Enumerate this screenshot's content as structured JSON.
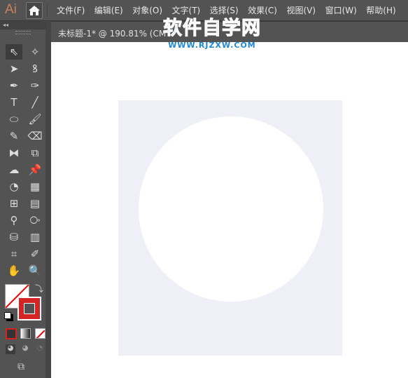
{
  "app": {
    "logo": "Ai",
    "home_icon": "home-icon"
  },
  "menu": [
    "文件(F)",
    "编辑(E)",
    "对象(O)",
    "文字(T)",
    "选择(S)",
    "效果(C)",
    "视图(V)",
    "窗口(W)",
    "帮助(H)"
  ],
  "document_tab": {
    "title": "未标题-1* @ 190.81% (CM"
  },
  "watermark": {
    "title": "软件自学网",
    "url": "WWW.RJZXW.COM"
  },
  "toolbar": {
    "collapse": "◂◂",
    "tools": [
      [
        "selection-tool",
        "⇖"
      ],
      [
        "magic-wand-tool",
        "✧"
      ],
      [
        "direct-selection-tool",
        "➤"
      ],
      [
        "lasso-tool",
        "ꝸ"
      ],
      [
        "pen-tool",
        "✒"
      ],
      [
        "curvature-tool",
        "✑"
      ],
      [
        "type-tool",
        "T"
      ],
      [
        "line-tool",
        "╱"
      ],
      [
        "ellipse-tool",
        "⬭"
      ],
      [
        "paintbrush-tool",
        "🖌"
      ],
      [
        "pencil-tool",
        "✎"
      ],
      [
        "eraser-tool",
        "⌫"
      ],
      [
        "reflect-tool",
        "⧓"
      ],
      [
        "scale-tool",
        "⧉"
      ],
      [
        "warp-tool",
        "☁"
      ],
      [
        "puppet-warp-tool",
        "📌"
      ],
      [
        "shape-builder-tool",
        "◔"
      ],
      [
        "perspective-grid-tool",
        "▦"
      ],
      [
        "mesh-tool",
        "⊞"
      ],
      [
        "gradient-tool",
        "▤"
      ],
      [
        "eyedropper-tool",
        "⚲"
      ],
      [
        "blend-tool",
        "⧂"
      ],
      [
        "symbol-sprayer-tool",
        "⛁"
      ],
      [
        "column-graph-tool",
        "▥"
      ],
      [
        "artboard-tool",
        "⌗"
      ],
      [
        "slice-tool",
        "✐"
      ],
      [
        "hand-tool",
        "✋"
      ],
      [
        "zoom-tool",
        "🔍"
      ]
    ]
  },
  "colors": {
    "fill": "none",
    "stroke": "#d42424",
    "artboard": "#efeff8",
    "watermark": "#1e88d8"
  }
}
